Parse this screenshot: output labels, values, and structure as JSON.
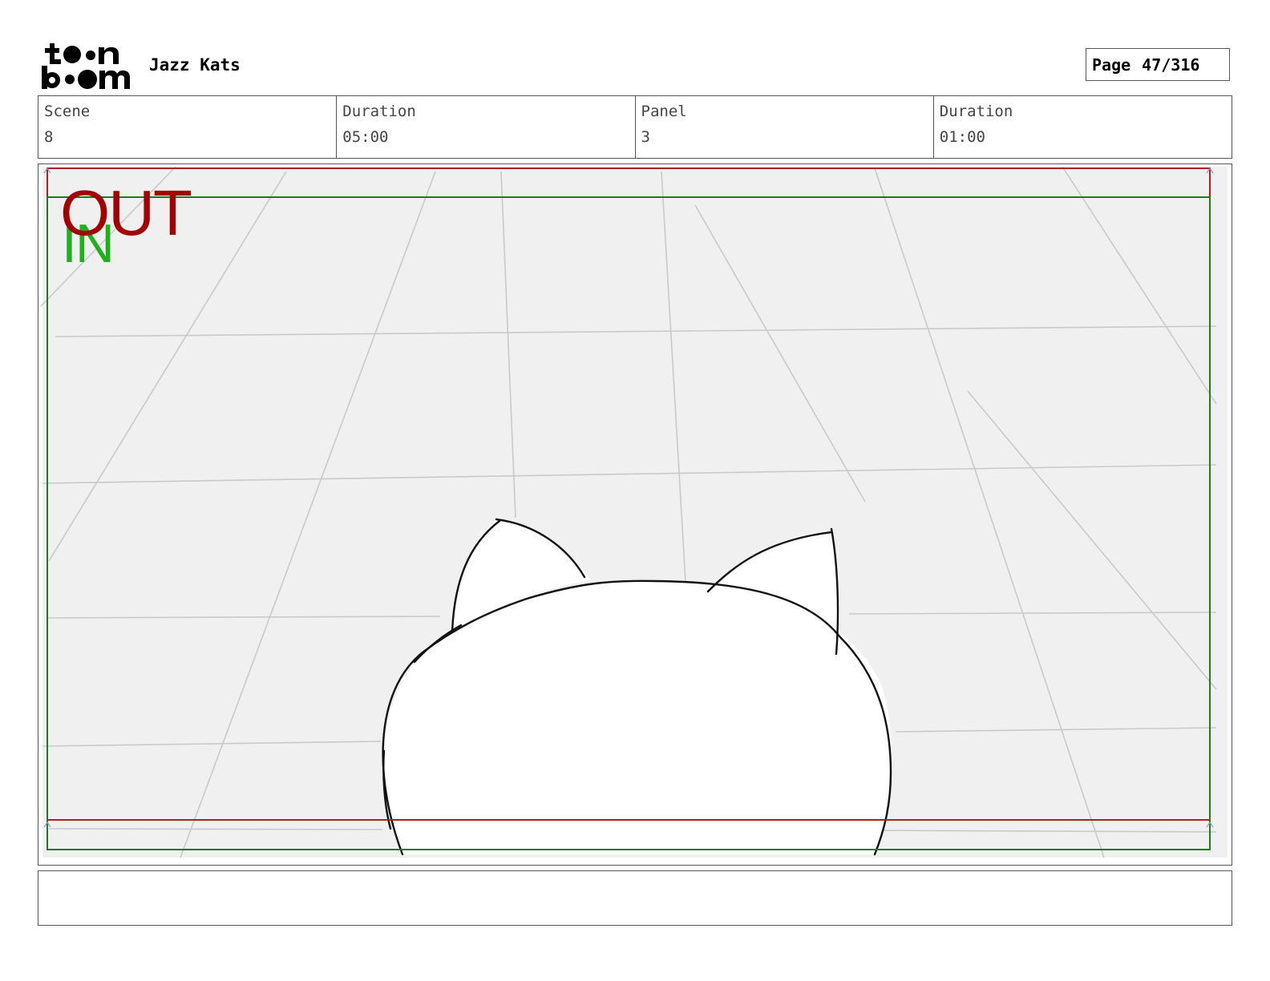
{
  "logo": {
    "name": "toon-boom-logo"
  },
  "header": {
    "project_title": "Jazz Kats",
    "page_label": "Page",
    "page_value": "47/316"
  },
  "info": {
    "scene_label": "Scene",
    "scene_value": "8",
    "scene_duration_label": "Duration",
    "scene_duration_value": "05:00",
    "panel_label": "Panel",
    "panel_value": "3",
    "panel_duration_label": "Duration",
    "panel_duration_value": "01:00"
  },
  "panel": {
    "out_label": "OUT",
    "in_label": "IN",
    "colors": {
      "out_frame": "#b01e1e",
      "in_frame": "#1d7a1d",
      "background": "#f0f0f0",
      "grid": "#c8c8c8"
    }
  },
  "caption": {
    "text": ""
  }
}
